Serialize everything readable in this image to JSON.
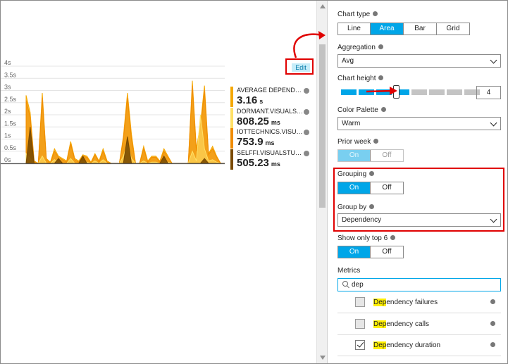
{
  "chart": {
    "edit_label": "Edit",
    "y_ticks": [
      "4s",
      "3.5s",
      "3s",
      "2.5s",
      "2s",
      "1.5s",
      "1s",
      "0.5s",
      "0s"
    ]
  },
  "chart_data": {
    "type": "area",
    "ylim": [
      0,
      4
    ],
    "y_unit": "s",
    "stacked": false,
    "series": [
      {
        "name": "AVERAGE DEPENDENCY...",
        "color": "#f5a800",
        "values": [
          2.8,
          2.1,
          0.1,
          0,
          2.9,
          0.2,
          0.05,
          0.6,
          0.3,
          0.2,
          0.1,
          0.9,
          0.2,
          0.1,
          0.35,
          0.3,
          0.05,
          0.4,
          0.1,
          0.6,
          0.1,
          0,
          0,
          0,
          1.1,
          2.9,
          1.2,
          0,
          0,
          0.7,
          0.1,
          0.3,
          0.3,
          0.1,
          0.6,
          0.3,
          0,
          0,
          0,
          0,
          0,
          3.4,
          0.6,
          1.6,
          3.2,
          0.4,
          0.7,
          0.3,
          0,
          0
        ]
      },
      {
        "name": "DORMANT.VISUALSTU...",
        "color": "#ffe066",
        "values": [
          0.4,
          0.2,
          0,
          0,
          0.3,
          0,
          0,
          0.15,
          0.05,
          0,
          0,
          0.2,
          0,
          0,
          0.1,
          0.05,
          0,
          0.1,
          0,
          0.15,
          0,
          0,
          0,
          0,
          0.3,
          0.8,
          0.2,
          0,
          0,
          0.1,
          0,
          0.05,
          0.05,
          0,
          0.1,
          0.05,
          0,
          0,
          0,
          0,
          0,
          0.5,
          0.1,
          2.0,
          0.6,
          0.1,
          0.15,
          0.05,
          0,
          0
        ]
      },
      {
        "name": "IOTTECHNICS.VISUALST...",
        "color": "#f08c00",
        "values": [
          2.6,
          1.9,
          0.05,
          0,
          2.7,
          0.15,
          0,
          0.5,
          0.25,
          0.15,
          0.05,
          0.8,
          0.15,
          0.05,
          0.3,
          0.25,
          0,
          0.35,
          0.05,
          0.5,
          0.05,
          0,
          0,
          0,
          1.0,
          2.7,
          1.0,
          0,
          0,
          0.6,
          0.05,
          0.25,
          0.25,
          0.05,
          0.5,
          0.25,
          0,
          0,
          0,
          0,
          0,
          3.2,
          0.5,
          1.4,
          3.0,
          0.35,
          0.6,
          0.25,
          0,
          0
        ]
      },
      {
        "name": "SELFFI.VISUALSTUDIO.C...",
        "color": "#7a4a00",
        "values": [
          0,
          1.5,
          0,
          0,
          0,
          0,
          0,
          0,
          0.2,
          0,
          0,
          0,
          0,
          0,
          0.3,
          0,
          0,
          0,
          0,
          0,
          0,
          0,
          0,
          0,
          0,
          1.1,
          0,
          0,
          0,
          0,
          0,
          0,
          0,
          0,
          0.3,
          0,
          0,
          0,
          0,
          0,
          0,
          0,
          0,
          0,
          0.2,
          0,
          0,
          0,
          0,
          0
        ]
      }
    ]
  },
  "legend": [
    {
      "name": "AVERAGE DEPENDENCY...",
      "value": "3.16",
      "unit": "s",
      "color": "#f5a800"
    },
    {
      "name": "DORMANT.VISUALSTU...",
      "value": "808.25",
      "unit": "ms",
      "color": "#ffe066"
    },
    {
      "name": "IOTTECHNICS.VISUALST...",
      "value": "753.9",
      "unit": "ms",
      "color": "#f08c00"
    },
    {
      "name": "SELFFI.VISUALSTUDIO.C...",
      "value": "505.23",
      "unit": "ms",
      "color": "#7a4a00"
    }
  ],
  "settings": {
    "chart_type": {
      "label": "Chart type",
      "options": [
        "Line",
        "Area",
        "Bar",
        "Grid"
      ],
      "selected": "Area"
    },
    "aggregation": {
      "label": "Aggregation",
      "value": "Avg"
    },
    "chart_height": {
      "label": "Chart height",
      "value": "4",
      "level": 4,
      "max": 10
    },
    "color_palette": {
      "label": "Color Palette",
      "value": "Warm"
    },
    "prior_week": {
      "label": "Prior week",
      "on": "On",
      "off": "Off",
      "selected": "On",
      "enabled": false
    },
    "grouping": {
      "label": "Grouping",
      "on": "On",
      "off": "Off",
      "selected": "On"
    },
    "group_by": {
      "label": "Group by",
      "value": "Dependency"
    },
    "top6": {
      "label": "Show only top 6",
      "on": "On",
      "off": "Off",
      "selected": "On"
    },
    "metrics": {
      "label": "Metrics",
      "search_value": "dep",
      "items": [
        {
          "match": "Dep",
          "rest": "endency failures",
          "checked": false
        },
        {
          "match": "Dep",
          "rest": "endency calls",
          "checked": false
        },
        {
          "match": "Dep",
          "rest": "endency duration",
          "checked": true
        }
      ]
    }
  },
  "colors": {
    "accent": "#00a6e8",
    "highlight": "#e00000"
  }
}
